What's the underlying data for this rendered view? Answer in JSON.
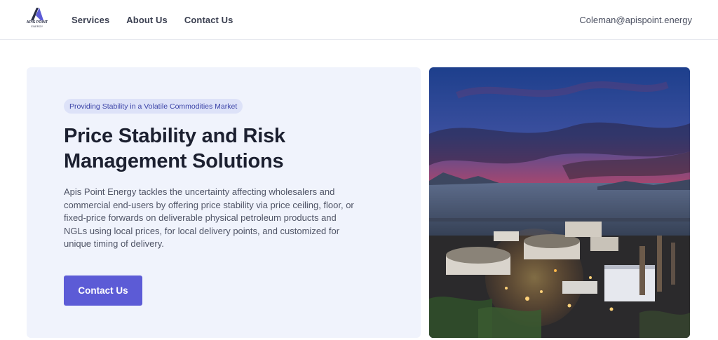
{
  "header": {
    "logo_text": "APIS POINT",
    "logo_subtext": "ENERGY",
    "nav": [
      "Services",
      "About Us",
      "Contact Us"
    ],
    "email": "Coleman@apispoint.energy"
  },
  "hero": {
    "badge": "Providing Stability in a Volatile Commodities Market",
    "title": "Price Stability and Risk Management Solutions",
    "description": "Apis Point Energy tackles the uncertainty affecting wholesalers and commercial end-users by offering price stability via price ceiling, floor, or fixed-price forwards on deliverable physical petroleum products and NGLs using local prices, for local delivery points, and customized for unique timing of delivery.",
    "cta_label": "Contact Us"
  },
  "colors": {
    "accent": "#5c5bd6",
    "card_bg": "#f0f3fc",
    "badge_bg": "#dde2f8"
  }
}
